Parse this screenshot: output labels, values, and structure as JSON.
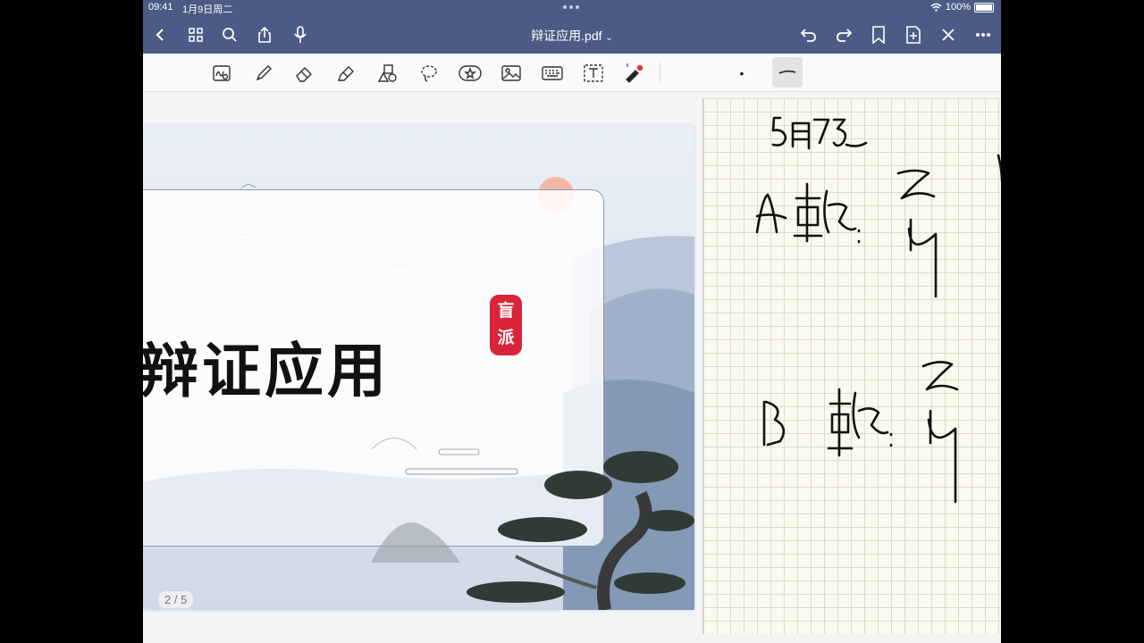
{
  "status": {
    "time": "09:41",
    "date": "1月9日周二",
    "battery": "100%"
  },
  "document": {
    "title": "辩证应用.pdf",
    "title_caret": "⌄"
  },
  "toolbar": {
    "tools": [
      "handwriting-search",
      "pen",
      "eraser",
      "highlighter",
      "shapes",
      "lasso",
      "sticker",
      "image",
      "keyboard",
      "text",
      "laser-pointer"
    ],
    "pen_size_dot": "•"
  },
  "slide": {
    "title": "辩证应用",
    "seal_line1": "盲",
    "seal_line2": "派",
    "page_indicator": "2 / 5"
  },
  "notes": {
    "handwriting": [
      "5月7日",
      "A 乾: 乙卯",
      "B 乾: 乙卯"
    ]
  },
  "colors": {
    "navbar": "#4b5b85",
    "seal": "#d8253a",
    "paper": "#fbfaee"
  }
}
